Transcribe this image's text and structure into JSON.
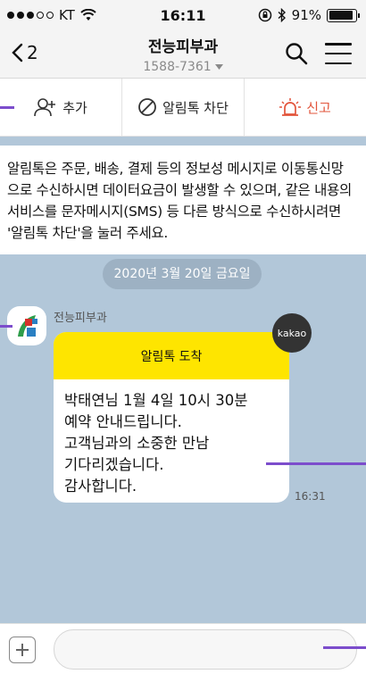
{
  "status_bar": {
    "carrier": "KT",
    "time": "16:11",
    "battery": "91%",
    "battery_level": 0.91
  },
  "header": {
    "back_count": "2",
    "title": "전능피부과",
    "subtitle": "1588-7361"
  },
  "actions": {
    "add_label": "추가",
    "block_label": "알림톡 차단",
    "report_label": "신고"
  },
  "notice": {
    "text": "알림톡은 주문, 배송, 결제 등의 정보성 메시지로 이동통신망으로 수신하시면 데이터요금이 발생할 수 있으며, 같은 내용의 서비스를 문자메시지(SMS) 등 다른 방식으로 수신하시려면 '알림톡 차단'을 눌러 주세요."
  },
  "date_divider": "2020년 3월 20일 금요일",
  "message": {
    "sender": "전능피부과",
    "header": "알림톡 도착",
    "lines": [
      "박태연님 1월 4일 10시 30분",
      "예약 안내드립니다.",
      "고객님과의 소중한 만남",
      "기다리겠습니다.",
      "감사합니다."
    ],
    "badge": "kakao",
    "time": "16:31"
  },
  "input": {
    "value": "",
    "placeholder": ""
  },
  "colors": {
    "chat_bg": "#b2c7d9",
    "bubble_header": "#fee500",
    "report": "#e2543b",
    "annotation": "#7c4dcc"
  }
}
